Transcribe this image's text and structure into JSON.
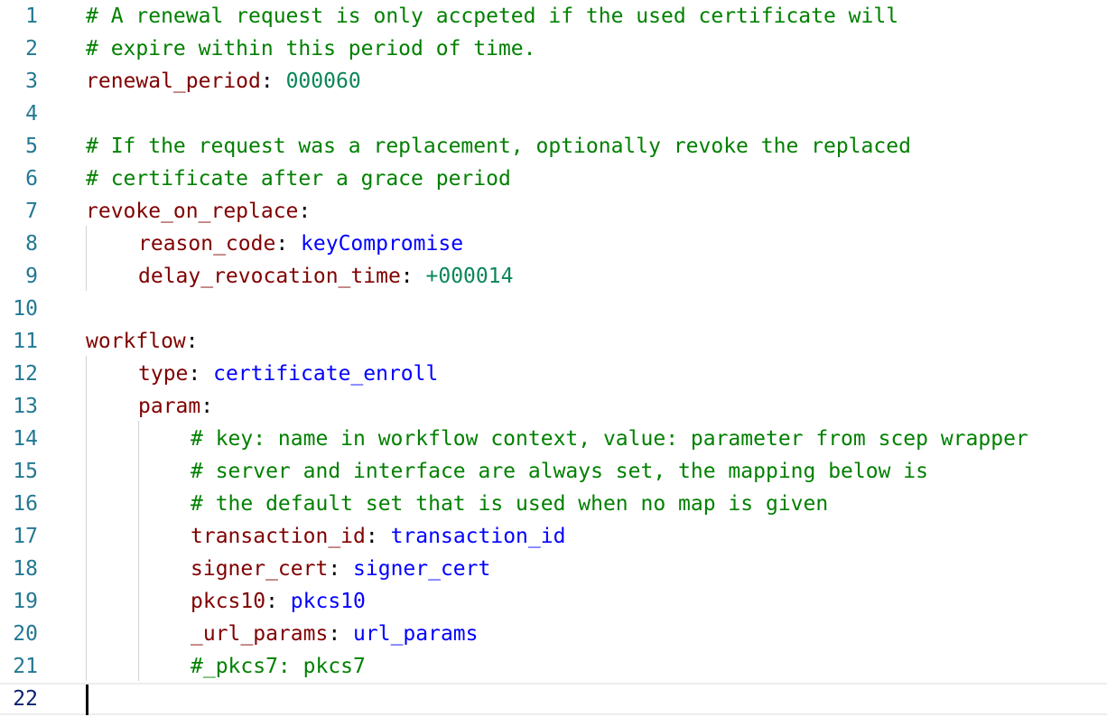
{
  "editor": {
    "lines": [
      {
        "num": "1",
        "indent": 0,
        "tokens": [
          {
            "t": "# A renewal request is only accpeted if the used certificate will",
            "c": "comment"
          }
        ]
      },
      {
        "num": "2",
        "indent": 0,
        "tokens": [
          {
            "t": "# expire within this period of time.",
            "c": "comment"
          }
        ]
      },
      {
        "num": "3",
        "indent": 0,
        "tokens": [
          {
            "t": "renewal_period",
            "c": "key"
          },
          {
            "t": ": ",
            "c": "punct"
          },
          {
            "t": "000060",
            "c": "num"
          }
        ]
      },
      {
        "num": "4",
        "indent": 0,
        "tokens": []
      },
      {
        "num": "5",
        "indent": 0,
        "tokens": [
          {
            "t": "# If the request was a replacement, optionally revoke the replaced",
            "c": "comment"
          }
        ]
      },
      {
        "num": "6",
        "indent": 0,
        "tokens": [
          {
            "t": "# certificate after a grace period",
            "c": "comment"
          }
        ]
      },
      {
        "num": "7",
        "indent": 0,
        "tokens": [
          {
            "t": "revoke_on_replace",
            "c": "key"
          },
          {
            "t": ":",
            "c": "punct"
          }
        ]
      },
      {
        "num": "8",
        "indent": 1,
        "tokens": [
          {
            "t": "reason_code",
            "c": "key"
          },
          {
            "t": ": ",
            "c": "punct"
          },
          {
            "t": "keyCompromise",
            "c": "str"
          }
        ]
      },
      {
        "num": "9",
        "indent": 1,
        "tokens": [
          {
            "t": "delay_revocation_time",
            "c": "key"
          },
          {
            "t": ": ",
            "c": "punct"
          },
          {
            "t": "+000014",
            "c": "num"
          }
        ]
      },
      {
        "num": "10",
        "indent": 0,
        "tokens": []
      },
      {
        "num": "11",
        "indent": 0,
        "tokens": [
          {
            "t": "workflow",
            "c": "key"
          },
          {
            "t": ":",
            "c": "punct"
          }
        ]
      },
      {
        "num": "12",
        "indent": 1,
        "tokens": [
          {
            "t": "type",
            "c": "key"
          },
          {
            "t": ": ",
            "c": "punct"
          },
          {
            "t": "certificate_enroll",
            "c": "str"
          }
        ]
      },
      {
        "num": "13",
        "indent": 1,
        "tokens": [
          {
            "t": "param",
            "c": "key"
          },
          {
            "t": ":",
            "c": "punct"
          }
        ]
      },
      {
        "num": "14",
        "indent": 2,
        "tokens": [
          {
            "t": "# key: name in workflow context, value: parameter from scep wrapper",
            "c": "comment"
          }
        ]
      },
      {
        "num": "15",
        "indent": 2,
        "tokens": [
          {
            "t": "# server and interface are always set, the mapping below is",
            "c": "comment"
          }
        ]
      },
      {
        "num": "16",
        "indent": 2,
        "tokens": [
          {
            "t": "# the default set that is used when no map is given",
            "c": "comment"
          }
        ]
      },
      {
        "num": "17",
        "indent": 2,
        "tokens": [
          {
            "t": "transaction_id",
            "c": "key"
          },
          {
            "t": ": ",
            "c": "punct"
          },
          {
            "t": "transaction_id",
            "c": "str"
          }
        ]
      },
      {
        "num": "18",
        "indent": 2,
        "tokens": [
          {
            "t": "signer_cert",
            "c": "key"
          },
          {
            "t": ": ",
            "c": "punct"
          },
          {
            "t": "signer_cert",
            "c": "str"
          }
        ]
      },
      {
        "num": "19",
        "indent": 2,
        "tokens": [
          {
            "t": "pkcs10",
            "c": "key"
          },
          {
            "t": ": ",
            "c": "punct"
          },
          {
            "t": "pkcs10",
            "c": "str"
          }
        ]
      },
      {
        "num": "20",
        "indent": 2,
        "tokens": [
          {
            "t": "_url_params",
            "c": "key"
          },
          {
            "t": ": ",
            "c": "punct"
          },
          {
            "t": "url_params",
            "c": "str"
          }
        ]
      },
      {
        "num": "21",
        "indent": 2,
        "tokens": [
          {
            "t": "#_pkcs7: pkcs7",
            "c": "comment"
          }
        ]
      },
      {
        "num": "22",
        "indent": 0,
        "tokens": [],
        "current": true
      }
    ]
  }
}
